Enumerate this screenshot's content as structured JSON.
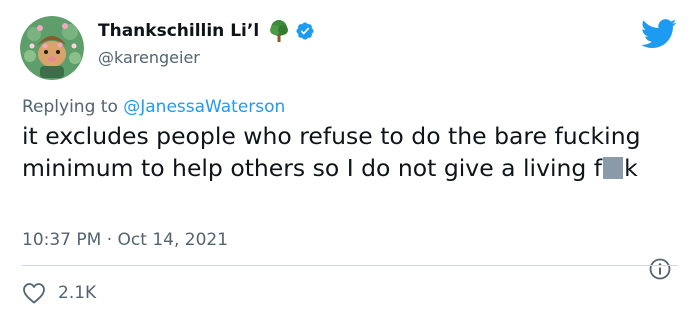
{
  "author": {
    "display_name": "Thankschillin Li’l",
    "username": "@karengeier"
  },
  "reply": {
    "prefix": "Replying to ",
    "handle": "@JanessaWaterson"
  },
  "tweet": {
    "text_before_censor": "it excludes people who refuse to do the bare fucking minimum to help others so I do not give a living f",
    "text_after_censor": "k"
  },
  "meta": {
    "time": "10:37 PM",
    "separator": " · ",
    "date": "Oct 14, 2021"
  },
  "actions": {
    "like_count": "2.1K"
  },
  "colors": {
    "twitter_blue": "#1d9bf0",
    "secondary_text": "#536471",
    "censor_gray": "#8a9aa8"
  },
  "icons": {
    "avatar": "avatar",
    "tree": "tree-icon",
    "verified": "verified-badge-icon",
    "brand": "twitter-bird-icon",
    "info": "info-icon",
    "like": "heart-icon"
  }
}
